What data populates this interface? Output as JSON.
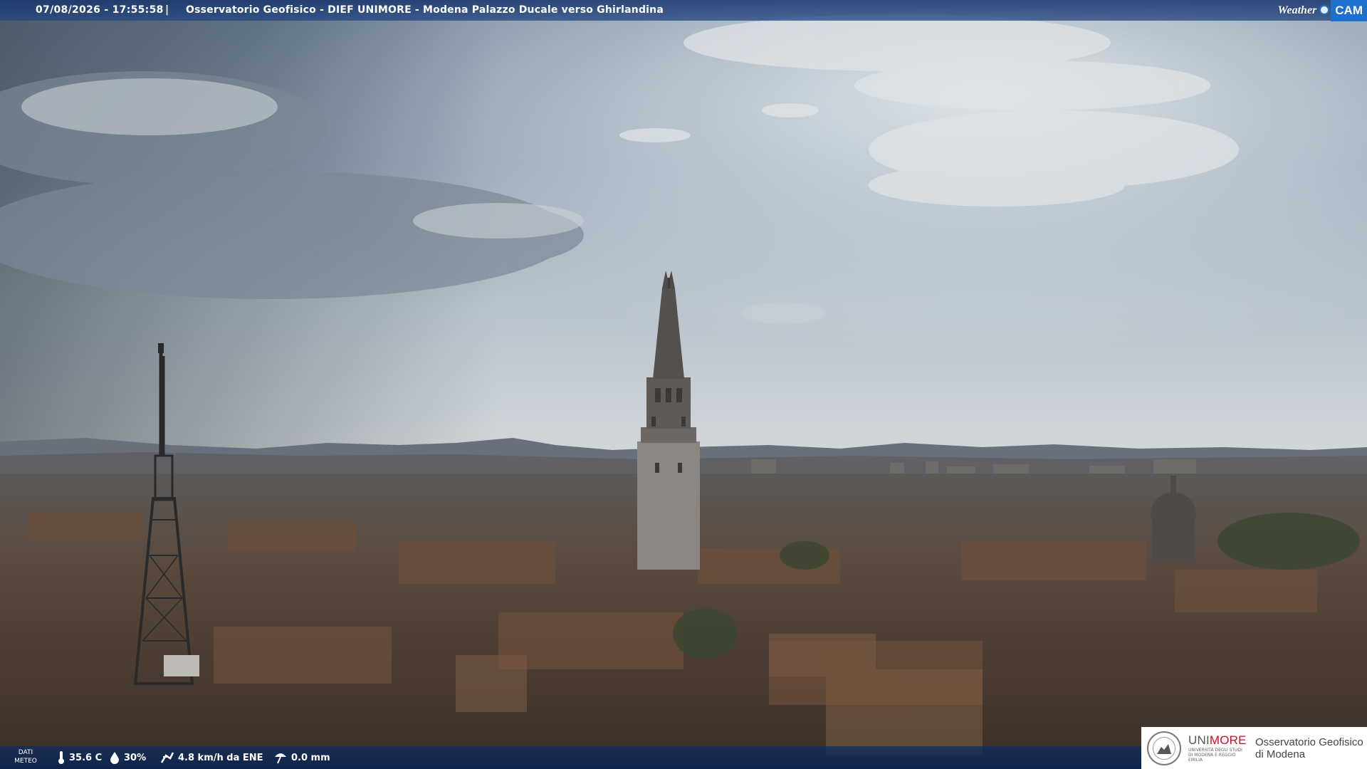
{
  "header": {
    "timestamp": "07/08/2026 - 17:55:58",
    "separator": "|",
    "title": "Osservatorio Geofisico - DIEF UNIMORE - Modena Palazzo Ducale verso Ghirlandina",
    "logo_part1": "Weather",
    "logo_part2": "CAM"
  },
  "weather": {
    "label_line1": "DATI",
    "label_line2": "METEO",
    "temperature": "35.6 C",
    "humidity": "30%",
    "wind": "4.8 km/h da ENE",
    "rain": "0.0 mm"
  },
  "organization": {
    "brand_prefix": "UNI",
    "brand_suffix": "MORE",
    "brand_sub": "UNIVERSITÀ DEGLI STUDI DI MODENA E REGGIO EMILIA",
    "name_line1": "Osservatorio Geofisico",
    "name_line2": "di Modena"
  },
  "icons": [
    "thermometer-icon",
    "humidity-drop-icon",
    "wind-icon",
    "rain-gauge-icon",
    "university-seal-icon"
  ],
  "colors": {
    "bar_blue": "#1e3f7a",
    "logo_blue": "#1e6fd0",
    "brand_red": "#c8102e"
  }
}
